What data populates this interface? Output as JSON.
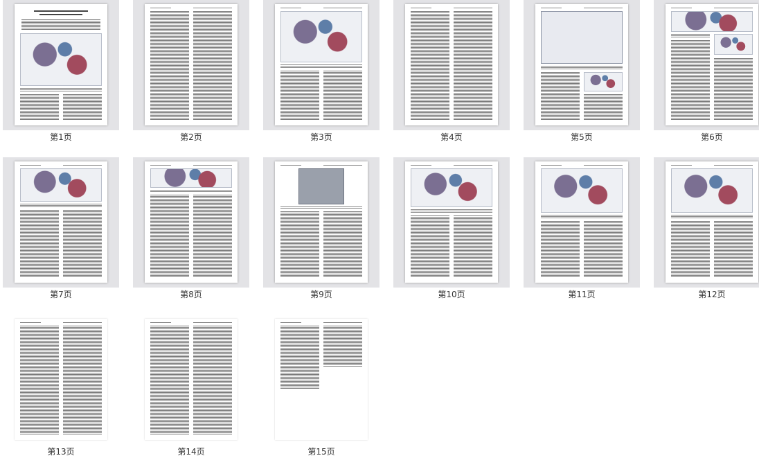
{
  "pages": [
    {
      "label": "第1页"
    },
    {
      "label": "第2页"
    },
    {
      "label": "第3页"
    },
    {
      "label": "第4页"
    },
    {
      "label": "第5页"
    },
    {
      "label": "第6页"
    },
    {
      "label": "第7页"
    },
    {
      "label": "第8页"
    },
    {
      "label": "第9页"
    },
    {
      "label": "第10页"
    },
    {
      "label": "第11页"
    },
    {
      "label": "第12页"
    },
    {
      "label": "第13页"
    },
    {
      "label": "第14页"
    },
    {
      "label": "第15页"
    }
  ],
  "colors": {
    "frame_bg": "#e3e3e6",
    "label_text": "#333333"
  }
}
